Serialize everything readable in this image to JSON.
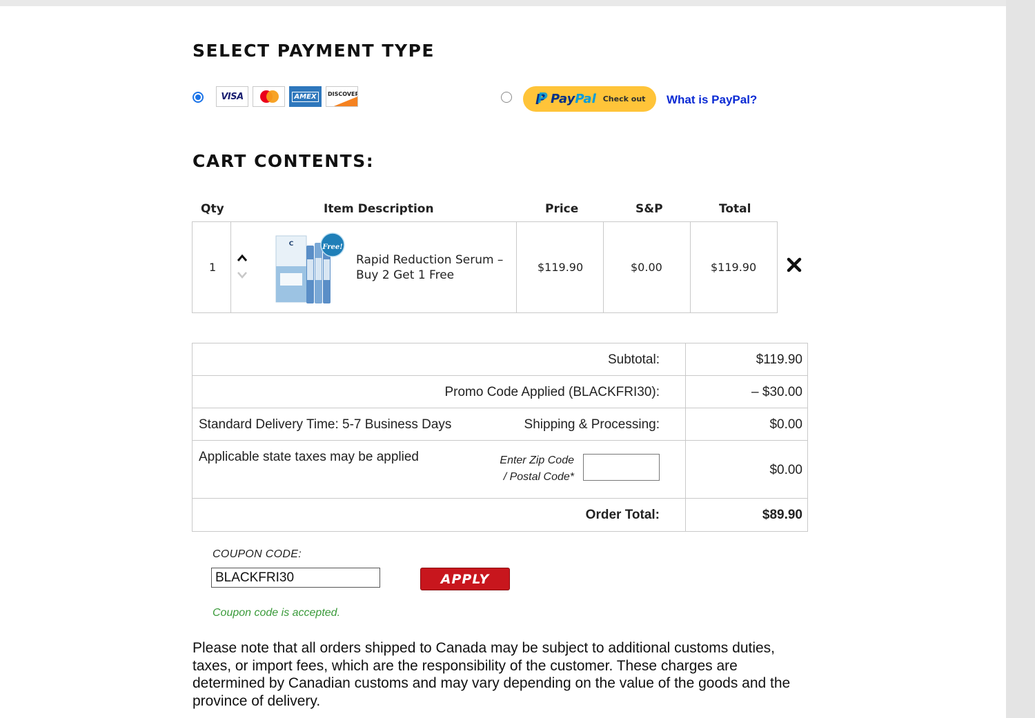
{
  "payment": {
    "title": "SELECT PAYMENT TYPE",
    "card_option_selected": true,
    "cards": [
      {
        "name": "visa",
        "label": "VISA"
      },
      {
        "name": "mastercard",
        "label": ""
      },
      {
        "name": "amex",
        "label": "AMEX"
      },
      {
        "name": "discover",
        "label": "DISCOVER"
      }
    ],
    "paypal": {
      "word_pay": "Pay",
      "word_pal": "Pal",
      "checkout_label": "Check out",
      "link_label": "What is PayPal?",
      "brand_color": "#ffc439"
    }
  },
  "cart": {
    "title": "CART CONTENTS:",
    "headers": {
      "qty": "Qty",
      "description": "Item Description",
      "price": "Price",
      "sp": "S&P",
      "total": "Total"
    },
    "items": [
      {
        "qty": "1",
        "name_line1": "Rapid Reduction Serum –",
        "name_line2": "Buy 2 Get 1 Free",
        "price": "$119.90",
        "sp": "$0.00",
        "total": "$119.90",
        "badge_text": "Free!"
      }
    ]
  },
  "totals": {
    "subtotal_label": "Subtotal:",
    "subtotal_value": "$119.90",
    "promo_label": "Promo Code Applied (BLACKFRI30):",
    "promo_value": "– $30.00",
    "delivery_note": "Standard Delivery Time: 5-7 Business Days",
    "shipping_label": "Shipping & Processing:",
    "shipping_value": "$0.00",
    "tax_note": "Applicable state taxes may be applied",
    "zip_label_line1": "Enter Zip Code",
    "zip_label_line2": "/ Postal Code*",
    "zip_value": "",
    "tax_value": "$0.00",
    "order_total_label": "Order Total:",
    "order_total_value": "$89.90"
  },
  "coupon": {
    "label": "COUPON CODE:",
    "value": "BLACKFRI30",
    "apply_label": "APPLY",
    "status": "Coupon code is accepted.",
    "status_color": "#3a9a3a",
    "apply_color": "#c8161d"
  },
  "notice": "Please note that all orders shipped to Canada may be subject to additional customs duties, taxes, or import fees, which are the responsibility of the customer. These charges are determined by Canadian customs and may vary depending on the value of the goods and the province of delivery."
}
